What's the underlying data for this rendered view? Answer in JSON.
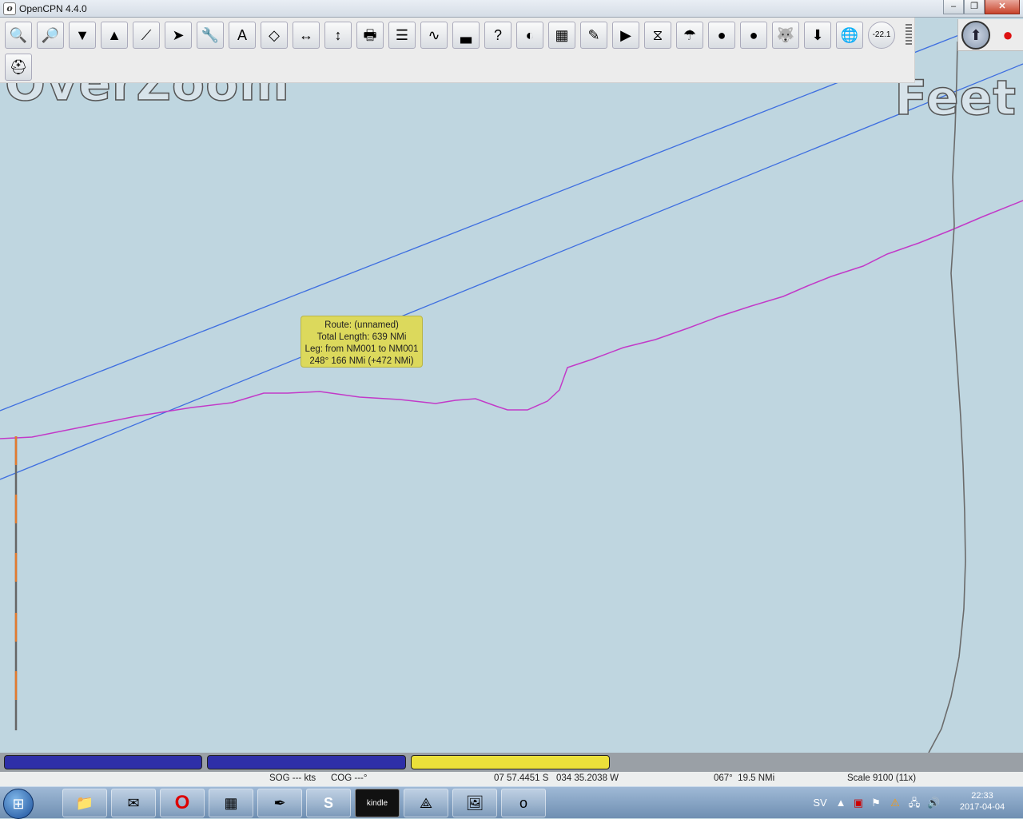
{
  "window": {
    "title": "OpenCPN 4.4.0",
    "minimize": "–",
    "maximize": "❐",
    "close": "✕"
  },
  "chart": {
    "overzoom_label": "OverZoom",
    "units_label": "Feet"
  },
  "toolbar": {
    "buttons": [
      {
        "name": "zoom-in-icon",
        "glyph": "🔍"
      },
      {
        "name": "zoom-out-icon",
        "glyph": "🔎"
      },
      {
        "name": "scale-in-icon",
        "glyph": "▼"
      },
      {
        "name": "scale-out-icon",
        "glyph": "▲"
      },
      {
        "name": "create-route-icon",
        "glyph": "⟋"
      },
      {
        "name": "auto-follow-icon",
        "glyph": "➤"
      },
      {
        "name": "options-icon",
        "glyph": "🔧"
      },
      {
        "name": "text-icon",
        "glyph": "A"
      },
      {
        "name": "current-icon",
        "glyph": "◇"
      },
      {
        "name": "tide-icon",
        "glyph": "↔"
      },
      {
        "name": "route-manager-icon",
        "glyph": "↕"
      },
      {
        "name": "print-icon",
        "glyph": "🖶"
      },
      {
        "name": "route-list-icon",
        "glyph": "☰"
      },
      {
        "name": "track-icon",
        "glyph": "∿"
      },
      {
        "name": "color-scheme-icon",
        "glyph": "▃"
      },
      {
        "name": "help-icon",
        "glyph": "?"
      },
      {
        "name": "night-mode-icon",
        "glyph": "◐"
      },
      {
        "name": "grib-icon",
        "glyph": "▦"
      },
      {
        "name": "chart-icon",
        "glyph": "✎"
      },
      {
        "name": "play-icon",
        "glyph": "▶"
      },
      {
        "name": "waypoint-icon",
        "glyph": "⧖"
      },
      {
        "name": "weather-icon",
        "glyph": "☂"
      },
      {
        "name": "record-icon",
        "glyph": "●"
      },
      {
        "name": "record-arrow-icon",
        "glyph": "●"
      },
      {
        "name": "husky-icon",
        "glyph": "🐺"
      },
      {
        "name": "download-icon",
        "glyph": "⬇"
      },
      {
        "name": "globe-icon",
        "glyph": "🌐"
      },
      {
        "name": "dashboard-icon",
        "glyph": "-22.1"
      },
      {
        "name": "mob-icon",
        "glyph": "⛑"
      }
    ]
  },
  "tooltip": {
    "line1": "Route: (unnamed)",
    "line2": "Total Length: 639 NMi",
    "line3": "Leg: from NM001 to NM001",
    "line4": "248°  166 NMi (+472 NMi)"
  },
  "piano": {
    "keys": [
      {
        "color": "#2e2fa8"
      },
      {
        "color": "#2e2fa8"
      },
      {
        "color": "#ebe03a"
      }
    ]
  },
  "status": {
    "sog": "SOG --- kts",
    "cog": "COG ---°",
    "position": "07 57.4451 S   034 35.2038 W",
    "bearing": "067°  19.5 NMi",
    "scale": "Scale 9100 (11x)"
  },
  "taskbar": {
    "apps": [
      {
        "name": "explorer-icon",
        "glyph": "📁"
      },
      {
        "name": "thunderbird-icon",
        "glyph": "✉"
      },
      {
        "name": "opera-icon",
        "glyph": "O"
      },
      {
        "name": "chess-icon",
        "glyph": "▦"
      },
      {
        "name": "pen-icon",
        "glyph": "✒"
      },
      {
        "name": "skype-icon",
        "glyph": "S"
      },
      {
        "name": "kindle-icon",
        "glyph": "kindle"
      },
      {
        "name": "acrobat-icon",
        "glyph": "⟁"
      },
      {
        "name": "photos-icon",
        "glyph": "🖼"
      },
      {
        "name": "opencpn-icon",
        "glyph": "o"
      }
    ],
    "language": "SV",
    "time": "22:33",
    "date": "2017-04-04"
  }
}
